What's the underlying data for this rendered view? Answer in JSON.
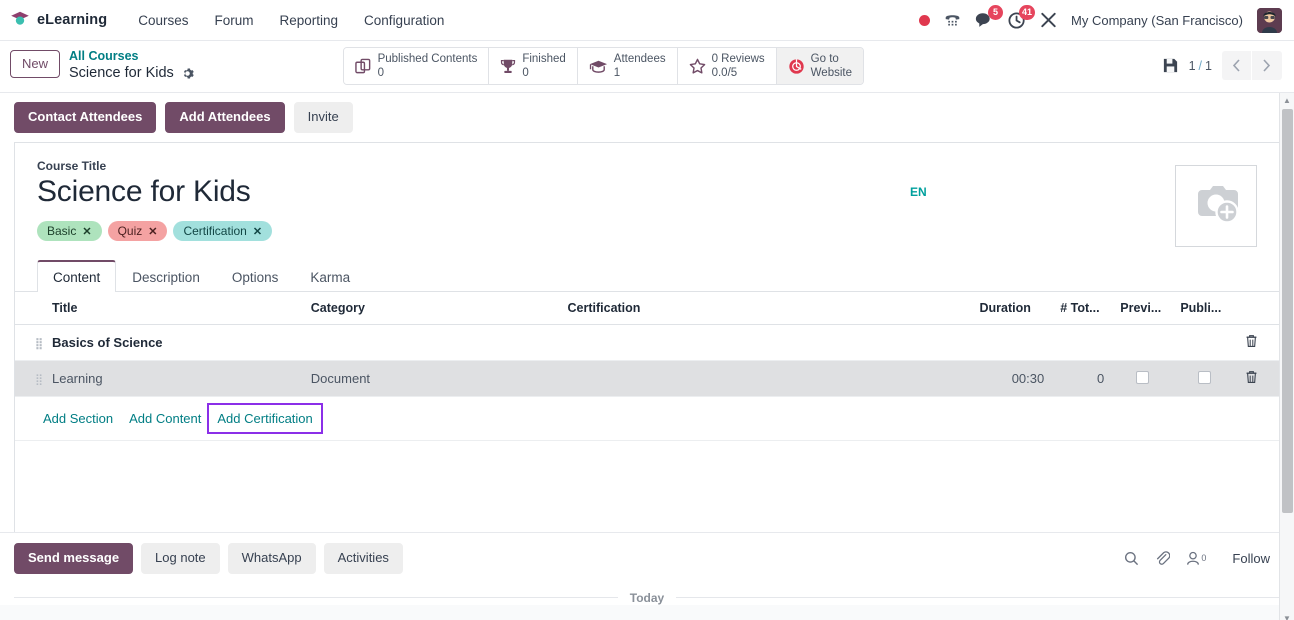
{
  "navbar": {
    "brand": "eLearning",
    "brand_icon": "graduation-cap-icon",
    "menu": [
      {
        "label": "Courses"
      },
      {
        "label": "Forum"
      },
      {
        "label": "Reporting"
      },
      {
        "label": "Configuration"
      }
    ],
    "systray": {
      "recording_indicator": "record-dot-icon",
      "phone_icon": "phone-dialpad-icon",
      "messages_icon": "chat-bubble-icon",
      "messages_count": "5",
      "activities_icon": "clock-icon",
      "activities_count": "41",
      "shortcuts_icon": "tools-icon",
      "company": "My Company (San Francisco)",
      "avatar": "user-avatar"
    }
  },
  "control_panel": {
    "new_button": "New",
    "breadcrumb_parent": "All Courses",
    "breadcrumb_current": "Science for Kids",
    "settings_icon": "gear-icon",
    "stat_buttons": [
      {
        "icon": "copy-pages-icon",
        "title": "Published Contents",
        "value": "0"
      },
      {
        "icon": "trophy-icon",
        "title": "Finished",
        "value": "0"
      },
      {
        "icon": "graduation-cap-icon",
        "title": "Attendees",
        "value": "1"
      },
      {
        "icon": "star-icon",
        "title": "0 Reviews",
        "value": "0.0/5"
      },
      {
        "icon": "globe-icon",
        "title": "Go to",
        "value": "Website"
      }
    ],
    "save_icon": "save-icon",
    "pager": {
      "current": "1",
      "separator": "/",
      "total": "1",
      "prev_icon": "chevron-left-icon",
      "next_icon": "chevron-right-icon"
    }
  },
  "action_bar": {
    "buttons": [
      {
        "label": "Contact Attendees",
        "style": "primary"
      },
      {
        "label": "Add Attendees",
        "style": "primary"
      },
      {
        "label": "Invite",
        "style": "secondary"
      }
    ]
  },
  "form": {
    "title_label": "Course Title",
    "title_value": "Science for Kids",
    "tags": [
      {
        "label": "Basic",
        "color": "#aee3bd",
        "remove_icon": "close-icon"
      },
      {
        "label": "Quiz",
        "color": "#f4a2a2",
        "remove_icon": "close-icon"
      },
      {
        "label": "Certification",
        "color": "#a2e0dd",
        "remove_icon": "close-icon"
      }
    ],
    "language_badge": "EN",
    "image_placeholder_icon": "camera-add-icon",
    "tabs": [
      {
        "label": "Content",
        "active": true
      },
      {
        "label": "Description",
        "active": false
      },
      {
        "label": "Options",
        "active": false
      },
      {
        "label": "Karma",
        "active": false
      }
    ]
  },
  "content_table": {
    "columns": [
      "Title",
      "Category",
      "Certification",
      "Duration",
      "# Tot...",
      "Previ...",
      "Publi..."
    ],
    "rows": [
      {
        "type": "section",
        "title": "Basics of Science",
        "category": "",
        "certification": "",
        "duration": "",
        "total": "",
        "preview": null,
        "published": null,
        "selected": false,
        "delete_icon": "trash-icon",
        "drag_icon": "drag-handle-icon"
      },
      {
        "type": "content",
        "title": "Learning",
        "category": "Document",
        "certification": "",
        "duration": "00:30",
        "total": "0",
        "preview": false,
        "published": false,
        "selected": true,
        "delete_icon": "trash-icon",
        "drag_icon": "drag-handle-icon"
      }
    ],
    "add_links": [
      {
        "label": "Add Section",
        "highlighted": false
      },
      {
        "label": "Add Content",
        "highlighted": false
      },
      {
        "label": "Add Certification",
        "highlighted": true
      }
    ],
    "highlight_color": "#8b2fe8"
  },
  "chatter": {
    "buttons": [
      {
        "label": "Send message",
        "style": "primary"
      },
      {
        "label": "Log note",
        "style": "secondary"
      },
      {
        "label": "WhatsApp",
        "style": "secondary"
      },
      {
        "label": "Activities",
        "style": "secondary"
      }
    ],
    "search_icon": "search-icon",
    "attachment_icon": "paperclip-icon",
    "followers_icon": "user-icon",
    "followers_count": "0",
    "follow_label": "Follow",
    "date_separator": "Today"
  },
  "scrollbar": {
    "up_icon": "caret-up-icon",
    "down_icon": "caret-down-icon"
  },
  "theme": {
    "primary": "#714B67",
    "link": "#017e84",
    "badge": "#e6455d"
  }
}
